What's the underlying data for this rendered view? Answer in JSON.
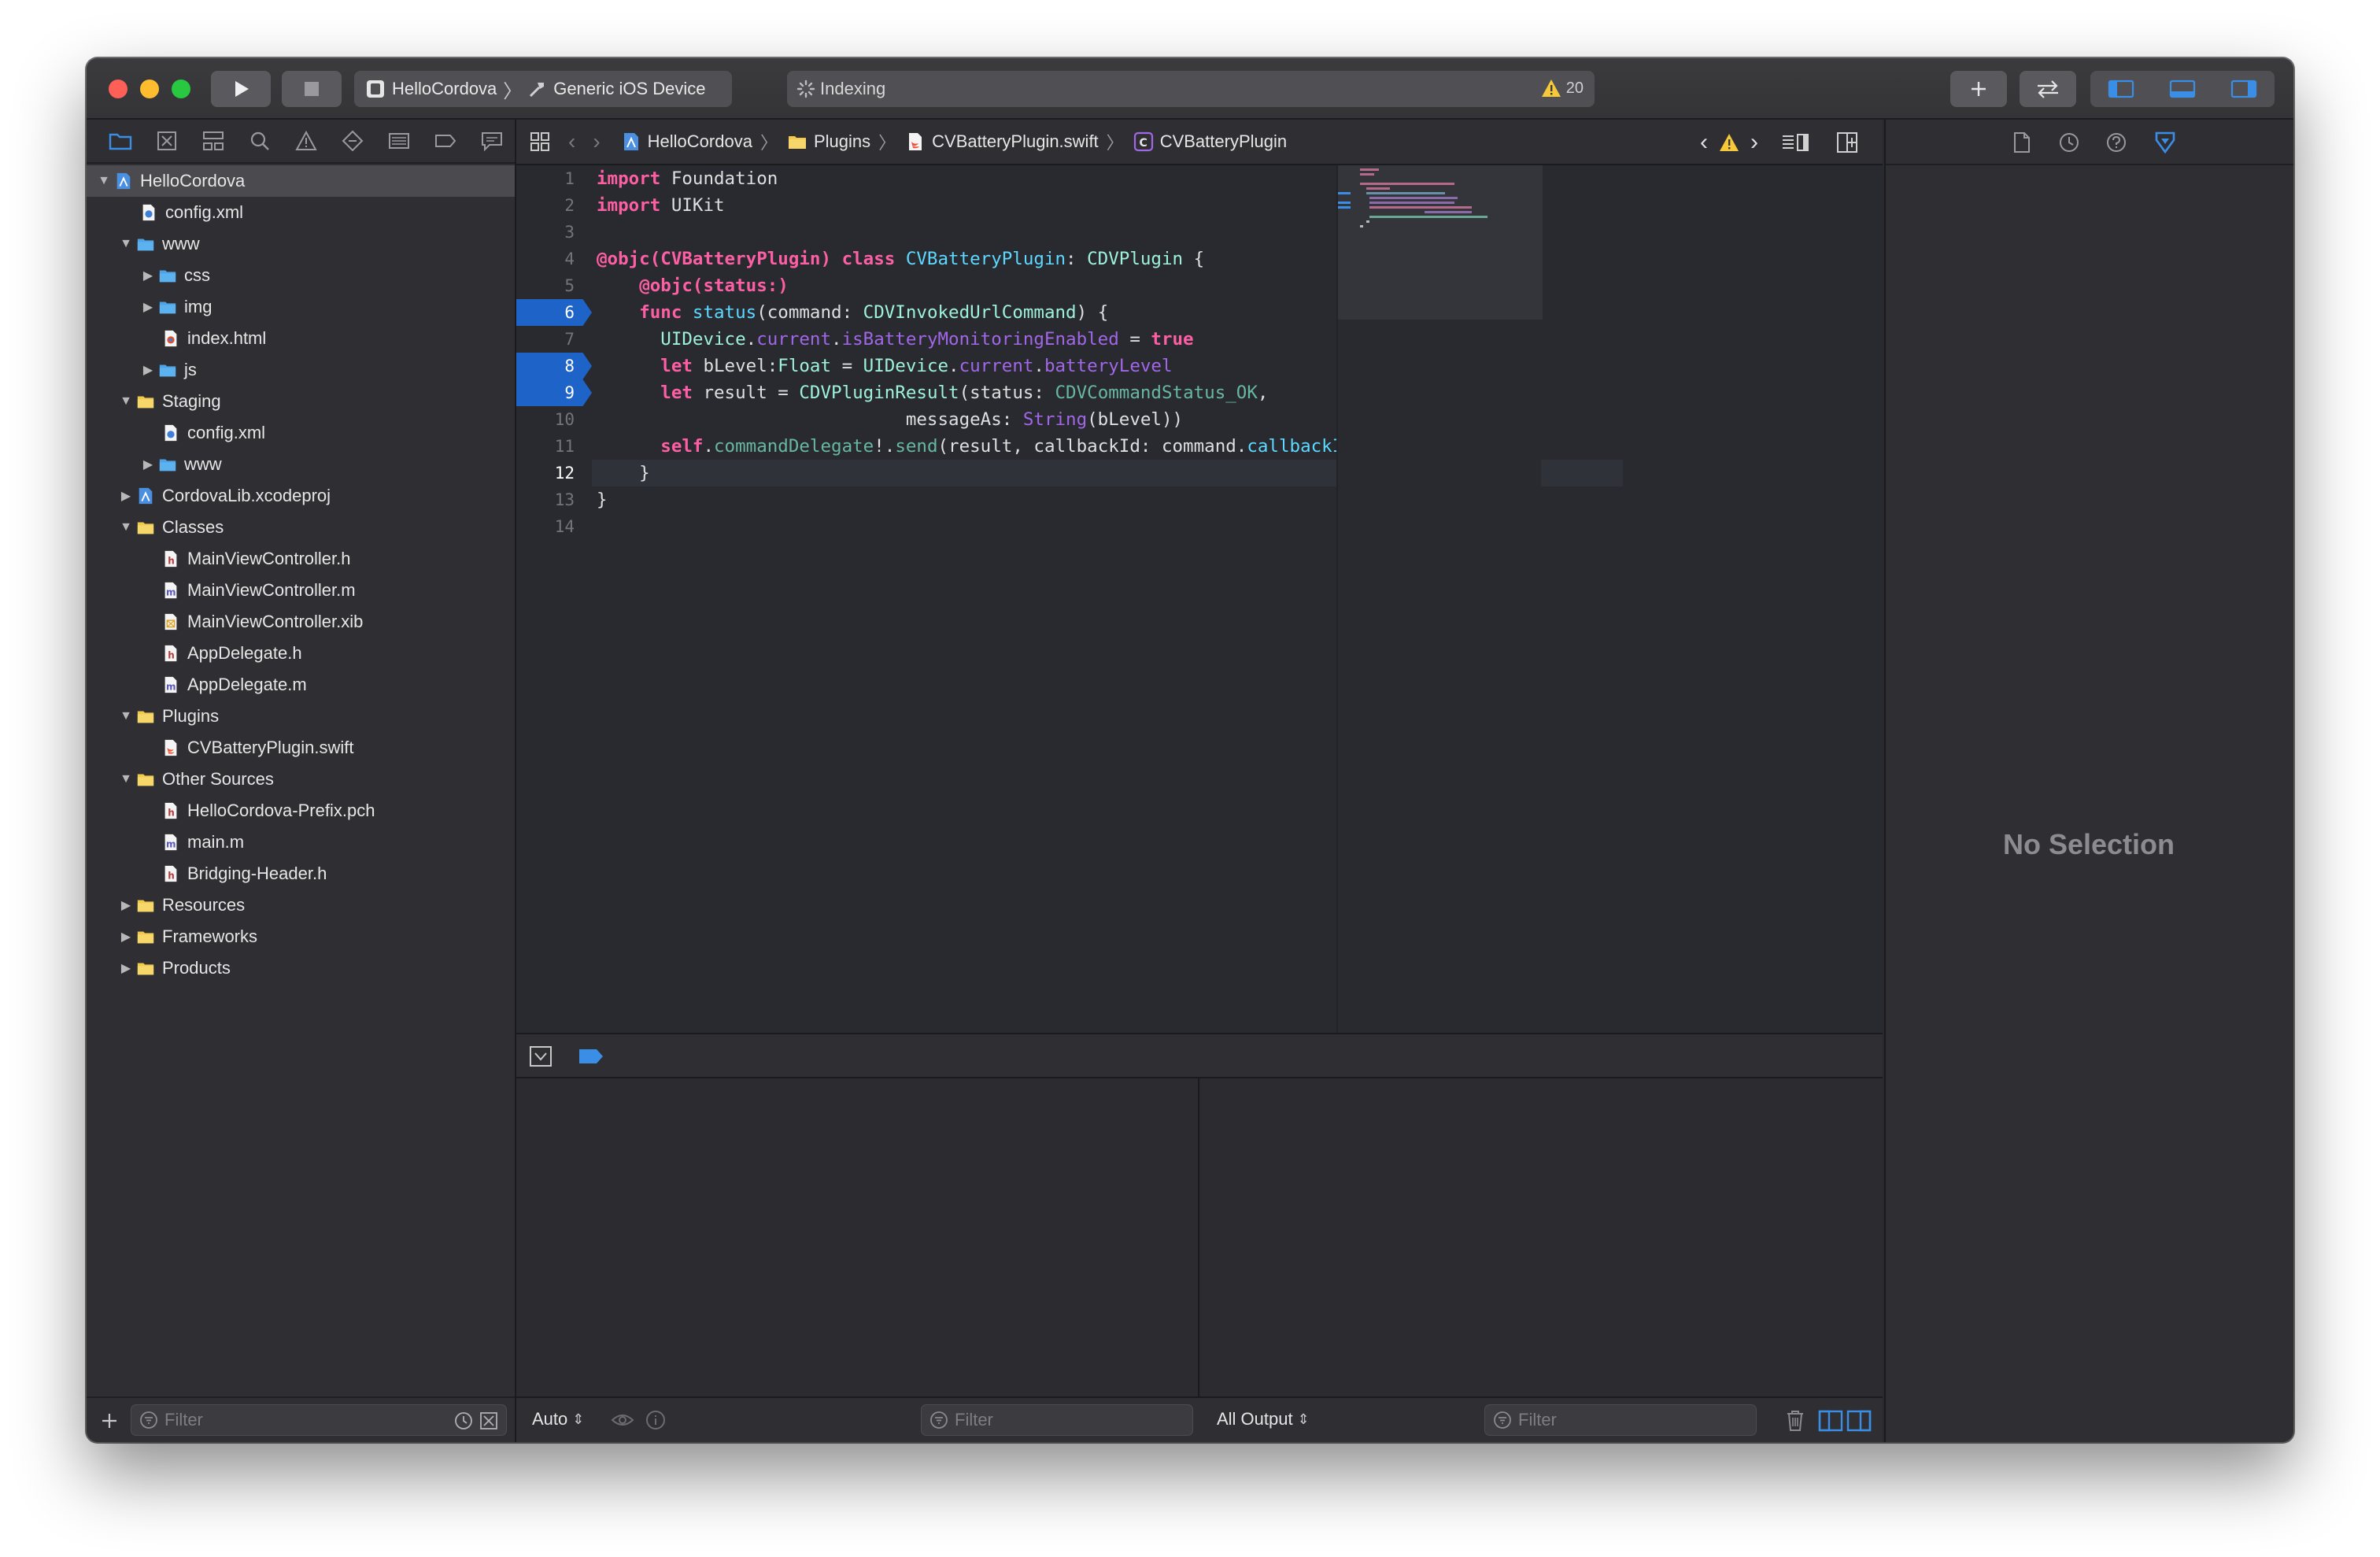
{
  "toolbar": {
    "scheme_target": "HelloCordova",
    "scheme_device": "Generic iOS Device",
    "activity_status": "Indexing",
    "warning_count": "20"
  },
  "navigator": {
    "filter_placeholder": "Filter",
    "tree": [
      {
        "label": "HelloCordova",
        "icon": "project-icon",
        "depth": 0,
        "disclosure": "open",
        "selected": true
      },
      {
        "label": "config.xml",
        "icon": "xml-file-icon",
        "depth": 1,
        "disclosure": "none"
      },
      {
        "label": "www",
        "icon": "blue-folder-icon",
        "depth": 1,
        "disclosure": "open"
      },
      {
        "label": "css",
        "icon": "blue-folder-icon",
        "depth": 2,
        "disclosure": "closed"
      },
      {
        "label": "img",
        "icon": "blue-folder-icon",
        "depth": 2,
        "disclosure": "closed"
      },
      {
        "label": "index.html",
        "icon": "html-file-icon",
        "depth": 2,
        "disclosure": "none"
      },
      {
        "label": "js",
        "icon": "blue-folder-icon",
        "depth": 2,
        "disclosure": "closed"
      },
      {
        "label": "Staging",
        "icon": "yellow-folder-icon",
        "depth": 1,
        "disclosure": "open"
      },
      {
        "label": "config.xml",
        "icon": "xml-file-icon",
        "depth": 2,
        "disclosure": "none"
      },
      {
        "label": "www",
        "icon": "blue-folder-icon",
        "depth": 2,
        "disclosure": "closed"
      },
      {
        "label": "CordovaLib.xcodeproj",
        "icon": "project-icon",
        "depth": 1,
        "disclosure": "closed"
      },
      {
        "label": "Classes",
        "icon": "yellow-folder-icon",
        "depth": 1,
        "disclosure": "open"
      },
      {
        "label": "MainViewController.h",
        "icon": "header-file-icon",
        "depth": 2,
        "disclosure": "none"
      },
      {
        "label": "MainViewController.m",
        "icon": "objc-file-icon",
        "depth": 2,
        "disclosure": "none"
      },
      {
        "label": "MainViewController.xib",
        "icon": "xib-file-icon",
        "depth": 2,
        "disclosure": "none"
      },
      {
        "label": "AppDelegate.h",
        "icon": "header-file-icon",
        "depth": 2,
        "disclosure": "none"
      },
      {
        "label": "AppDelegate.m",
        "icon": "objc-file-icon",
        "depth": 2,
        "disclosure": "none"
      },
      {
        "label": "Plugins",
        "icon": "yellow-folder-icon",
        "depth": 1,
        "disclosure": "open"
      },
      {
        "label": "CVBatteryPlugin.swift",
        "icon": "swift-file-icon",
        "depth": 2,
        "disclosure": "none"
      },
      {
        "label": "Other Sources",
        "icon": "yellow-folder-icon",
        "depth": 1,
        "disclosure": "open"
      },
      {
        "label": "HelloCordova-Prefix.pch",
        "icon": "header-file-icon",
        "depth": 2,
        "disclosure": "none"
      },
      {
        "label": "main.m",
        "icon": "objc-file-icon",
        "depth": 2,
        "disclosure": "none"
      },
      {
        "label": "Bridging-Header.h",
        "icon": "header-file-icon",
        "depth": 2,
        "disclosure": "none"
      },
      {
        "label": "Resources",
        "icon": "yellow-folder-icon",
        "depth": 1,
        "disclosure": "closed"
      },
      {
        "label": "Frameworks",
        "icon": "yellow-folder-icon",
        "depth": 1,
        "disclosure": "closed"
      },
      {
        "label": "Products",
        "icon": "yellow-folder-icon",
        "depth": 1,
        "disclosure": "closed"
      }
    ]
  },
  "jumpbar": {
    "crumbs": [
      {
        "label": "HelloCordova",
        "icon": "project-icon"
      },
      {
        "label": "Plugins",
        "icon": "yellow-folder-icon"
      },
      {
        "label": "CVBatteryPlugin.swift",
        "icon": "swift-file-icon"
      },
      {
        "label": "CVBatteryPlugin",
        "icon": "class-icon"
      }
    ]
  },
  "editor": {
    "breakpoint_lines": [
      6,
      8,
      9
    ],
    "current_line": 12,
    "lines": [
      [
        {
          "t": "import",
          "c": "kw"
        },
        {
          "t": " Foundation"
        }
      ],
      [
        {
          "t": "import",
          "c": "kw"
        },
        {
          "t": " UIKit"
        }
      ],
      [],
      [
        {
          "t": "@objc(CVBatteryPlugin)",
          "c": "kw"
        },
        {
          "t": " "
        },
        {
          "t": "class",
          "c": "kw"
        },
        {
          "t": " "
        },
        {
          "t": "CVBatteryPlugin",
          "c": "ty"
        },
        {
          "t": ": "
        },
        {
          "t": "CDVPlugin",
          "c": "cls"
        },
        {
          "t": " {"
        }
      ],
      [
        {
          "t": "    "
        },
        {
          "t": "@objc(status:)",
          "c": "kw"
        }
      ],
      [
        {
          "t": "    "
        },
        {
          "t": "func",
          "c": "kw"
        },
        {
          "t": " "
        },
        {
          "t": "status",
          "c": "ty"
        },
        {
          "t": "(command: "
        },
        {
          "t": "CDVInvokedUrlCommand",
          "c": "cls"
        },
        {
          "t": ") {"
        }
      ],
      [
        {
          "t": "      "
        },
        {
          "t": "UIDevice",
          "c": "cls"
        },
        {
          "t": "."
        },
        {
          "t": "current",
          "c": "sy"
        },
        {
          "t": "."
        },
        {
          "t": "isBatteryMonitoringEnabled",
          "c": "sy"
        },
        {
          "t": " = "
        },
        {
          "t": "true",
          "c": "kw"
        }
      ],
      [
        {
          "t": "      "
        },
        {
          "t": "let",
          "c": "kw"
        },
        {
          "t": " bLevel:"
        },
        {
          "t": "Float",
          "c": "cls"
        },
        {
          "t": " = "
        },
        {
          "t": "UIDevice",
          "c": "cls"
        },
        {
          "t": "."
        },
        {
          "t": "current",
          "c": "sy"
        },
        {
          "t": "."
        },
        {
          "t": "batteryLevel",
          "c": "sy"
        }
      ],
      [
        {
          "t": "      "
        },
        {
          "t": "let",
          "c": "kw"
        },
        {
          "t": " result = "
        },
        {
          "t": "CDVPluginResult",
          "c": "cls"
        },
        {
          "t": "(status: "
        },
        {
          "t": "CDVCommandStatus_OK",
          "c": "fn"
        },
        {
          "t": ","
        }
      ],
      [
        {
          "t": "                             messageAs: "
        },
        {
          "t": "String",
          "c": "sy"
        },
        {
          "t": "(bLevel))"
        }
      ],
      [
        {
          "t": "      "
        },
        {
          "t": "self",
          "c": "kw"
        },
        {
          "t": "."
        },
        {
          "t": "commandDelegate",
          "c": "fn"
        },
        {
          "t": "!."
        },
        {
          "t": "send",
          "c": "fn"
        },
        {
          "t": "(result, callbackId: command."
        },
        {
          "t": "callbackId",
          "c": "ty"
        },
        {
          "t": ")"
        }
      ],
      [
        {
          "t": "    }"
        }
      ],
      [
        {
          "t": "}"
        }
      ],
      []
    ]
  },
  "debug": {
    "variables_scope": "Auto",
    "variables_filter_placeholder": "Filter",
    "console_scope": "All Output",
    "console_filter_placeholder": "Filter"
  },
  "inspector": {
    "empty_label": "No Selection"
  },
  "colors": {
    "keyword": "#fc5fa3",
    "type_decl": "#5dd8ff",
    "type_ref": "#9ef1dd",
    "member": "#a167e6",
    "function": "#67b7a4",
    "breakpoint": "#1e64c8",
    "accent": "#3a8ee6"
  }
}
